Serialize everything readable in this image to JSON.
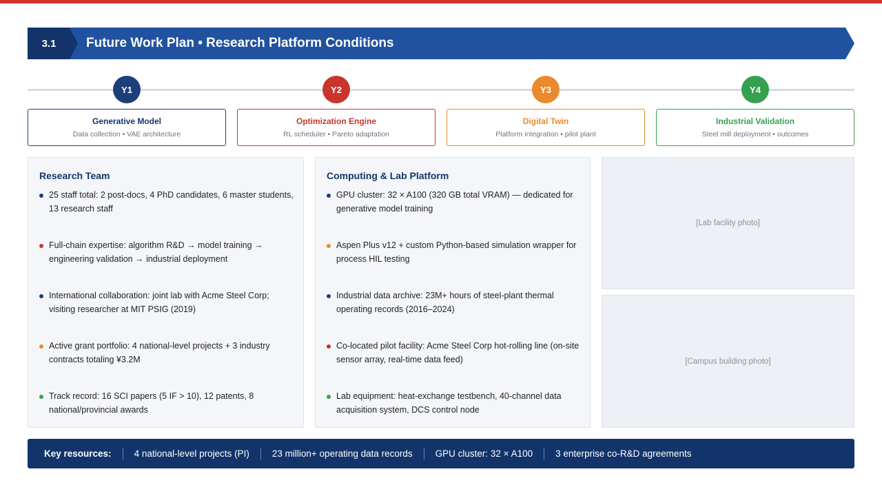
{
  "header": {
    "section_number": "3.1",
    "title": "Future Work Plan  •  Research Platform Conditions",
    "accent_color": "#d0342c",
    "primary_color": "#2152a0",
    "dark_color": "#12346b"
  },
  "timeline": [
    {
      "year": "Y1",
      "color": "#1c3f7c",
      "title": "Generative Model",
      "subtitle": "Data collection  •  VAE architecture"
    },
    {
      "year": "Y2",
      "color": "#c8352b",
      "title": "Optimization Engine",
      "subtitle": "RL scheduler  •  Pareto adaptation"
    },
    {
      "year": "Y3",
      "color": "#e98b2c",
      "title": "Digital Twin",
      "subtitle": "Platform integration  •  pilot plant"
    },
    {
      "year": "Y4",
      "color": "#35a050",
      "title": "Industrial Validation",
      "subtitle": "Steel mill deployment  •  outcomes"
    }
  ],
  "research_team": {
    "title": "Research Team",
    "items": [
      {
        "text": "25 staff total: 2 post-docs, 4 PhD candidates, 6 master students, 13 research staff",
        "color": "#1c3f7c"
      },
      {
        "text": "Full-chain expertise: algorithm R&D → model training → engineering validation → industrial deployment",
        "color": "#c8352b"
      },
      {
        "text": "International collaboration: joint lab with Acme Steel Corp; visiting researcher at MIT PSIG (2019)",
        "color": "#1c3f7c"
      },
      {
        "text": "Active grant portfolio: 4 national-level projects + 3 industry contracts totaling ¥3.2M",
        "color": "#e98b2c"
      },
      {
        "text": "Track record: 16 SCI papers (5 IF > 10), 12 patents, 8 national/provincial awards",
        "color": "#35a050"
      }
    ]
  },
  "computing_platform": {
    "title": "Computing & Lab Platform",
    "items": [
      {
        "text": "GPU cluster: 32 × A100 (320 GB total VRAM) — dedicated for generative model training",
        "color": "#1c3f7c"
      },
      {
        "text": "Aspen Plus v12 + custom Python-based simulation wrapper for process HIL testing",
        "color": "#e98b2c"
      },
      {
        "text": "Industrial data archive: 23M+ hours of steel-plant thermal operating records (2016–2024)",
        "color": "#1c3f7c"
      },
      {
        "text": "Co-located pilot facility: Acme Steel Corp hot-rolling line (on-site sensor array, real-time data feed)",
        "color": "#c8352b"
      },
      {
        "text": "Lab equipment: heat-exchange testbench, 40-channel data acquisition system, DCS control node",
        "color": "#35a050"
      }
    ]
  },
  "photos": {
    "lab": "[Lab facility photo]",
    "campus": "[Campus building photo]"
  },
  "footer": {
    "label": "Key resources:",
    "items": [
      "4 national-level projects (PI)",
      "23 million+ operating data records",
      "GPU cluster: 32 × A100",
      "3 enterprise co-R&D agreements"
    ]
  }
}
